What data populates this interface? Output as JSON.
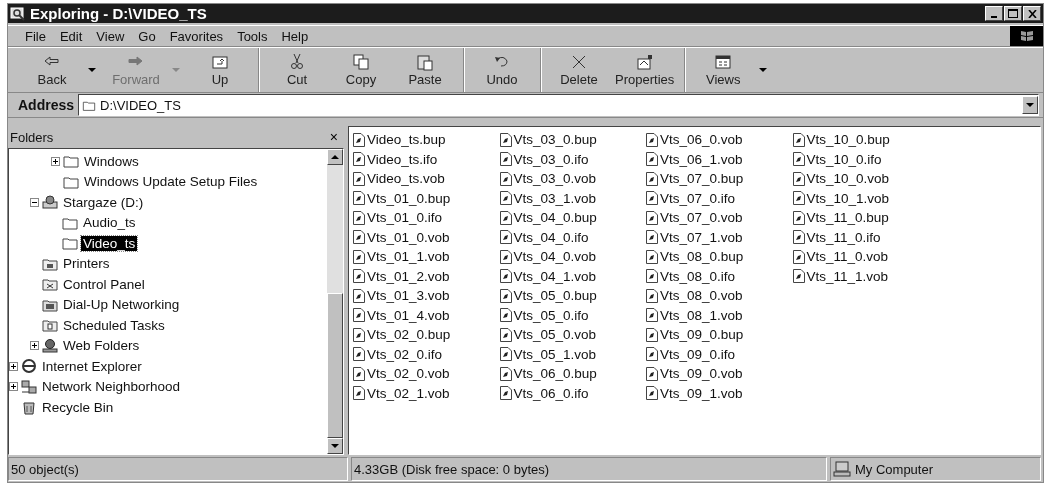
{
  "window": {
    "title": "Exploring - D:\\VIDEO_TS"
  },
  "menu": [
    "File",
    "Edit",
    "View",
    "Go",
    "Favorites",
    "Tools",
    "Help"
  ],
  "toolbar": [
    [
      {
        "label": "Back",
        "kind": "back",
        "disabled": false,
        "dropdown": true
      },
      {
        "label": "Forward",
        "kind": "forward",
        "disabled": true,
        "dropdown": true
      },
      {
        "label": "Up",
        "kind": "up",
        "disabled": false,
        "dropdown": false
      }
    ],
    [
      {
        "label": "Cut",
        "kind": "cut",
        "disabled": false,
        "dropdown": false
      },
      {
        "label": "Copy",
        "kind": "copy",
        "disabled": false,
        "dropdown": false
      },
      {
        "label": "Paste",
        "kind": "paste",
        "disabled": false,
        "dropdown": false
      }
    ],
    [
      {
        "label": "Undo",
        "kind": "undo",
        "disabled": false,
        "dropdown": false
      }
    ],
    [
      {
        "label": "Delete",
        "kind": "delete",
        "disabled": false,
        "dropdown": false
      },
      {
        "label": "Properties",
        "kind": "properties",
        "disabled": false,
        "dropdown": false
      }
    ],
    [
      {
        "label": "Views",
        "kind": "views",
        "disabled": false,
        "dropdown": true
      }
    ]
  ],
  "address": {
    "label": "Address",
    "value": "D:\\VIDEO_TS"
  },
  "folders": {
    "title": "Folders",
    "close": "×",
    "tree": [
      {
        "children": [
          {
            "children": [
              {
                "label": "Windows",
                "kind": "folder",
                "expandable": true,
                "expanded": false,
                "selected": false
              },
              {
                "label": "Windows Update Setup Files",
                "kind": "folder",
                "expandable": false,
                "selected": false
              }
            ]
          },
          {
            "label": "Stargaze (D:)",
            "kind": "drive",
            "expandable": true,
            "expanded": true,
            "selected": false,
            "children": [
              {
                "label": "Audio_ts",
                "kind": "folder",
                "expandable": false,
                "selected": false
              },
              {
                "label": "Video_ts",
                "kind": "folder",
                "expandable": false,
                "selected": true
              }
            ]
          },
          {
            "label": "Printers",
            "kind": "printers",
            "expandable": false,
            "selected": false
          },
          {
            "label": "Control Panel",
            "kind": "control-panel",
            "expandable": false,
            "selected": false
          },
          {
            "label": "Dial-Up Networking",
            "kind": "dialup",
            "expandable": false,
            "selected": false
          },
          {
            "label": "Scheduled Tasks",
            "kind": "tasks",
            "expandable": false,
            "selected": false
          },
          {
            "label": "Web Folders",
            "kind": "web",
            "expandable": true,
            "expanded": false,
            "selected": false
          }
        ]
      },
      {
        "label": "Internet Explorer",
        "kind": "ie",
        "expandable": true,
        "expanded": false,
        "selected": false
      },
      {
        "label": "Network Neighborhood",
        "kind": "network",
        "expandable": true,
        "expanded": false,
        "selected": false
      },
      {
        "label": "Recycle Bin",
        "kind": "recycle",
        "expandable": false,
        "selected": false
      }
    ]
  },
  "files": [
    "Video_ts.bup",
    "Video_ts.ifo",
    "Video_ts.vob",
    "Vts_01_0.bup",
    "Vts_01_0.ifo",
    "Vts_01_0.vob",
    "Vts_01_1.vob",
    "Vts_01_2.vob",
    "Vts_01_3.vob",
    "Vts_01_4.vob",
    "Vts_02_0.bup",
    "Vts_02_0.ifo",
    "Vts_02_0.vob",
    "Vts_02_1.vob",
    "Vts_03_0.bup",
    "Vts_03_0.ifo",
    "Vts_03_0.vob",
    "Vts_03_1.vob",
    "Vts_04_0.bup",
    "Vts_04_0.ifo",
    "Vts_04_0.vob",
    "Vts_04_1.vob",
    "Vts_05_0.bup",
    "Vts_05_0.ifo",
    "Vts_05_0.vob",
    "Vts_05_1.vob",
    "Vts_06_0.bup",
    "Vts_06_0.ifo",
    "Vts_06_0.vob",
    "Vts_06_1.vob",
    "Vts_07_0.bup",
    "Vts_07_0.ifo",
    "Vts_07_0.vob",
    "Vts_07_1.vob",
    "Vts_08_0.bup",
    "Vts_08_0.ifo",
    "Vts_08_0.vob",
    "Vts_08_1.vob",
    "Vts_09_0.bup",
    "Vts_09_0.ifo",
    "Vts_09_0.vob",
    "Vts_09_1.vob",
    "Vts_10_0.bup",
    "Vts_10_0.ifo",
    "Vts_10_0.vob",
    "Vts_10_1.vob",
    "Vts_11_0.bup",
    "Vts_11_0.ifo",
    "Vts_11_0.vob",
    "Vts_11_1.vob"
  ],
  "status_bar": {
    "objects": "50 object(s)",
    "size": "4.33GB (Disk free space: 0 bytes)",
    "zone": "My Computer"
  }
}
